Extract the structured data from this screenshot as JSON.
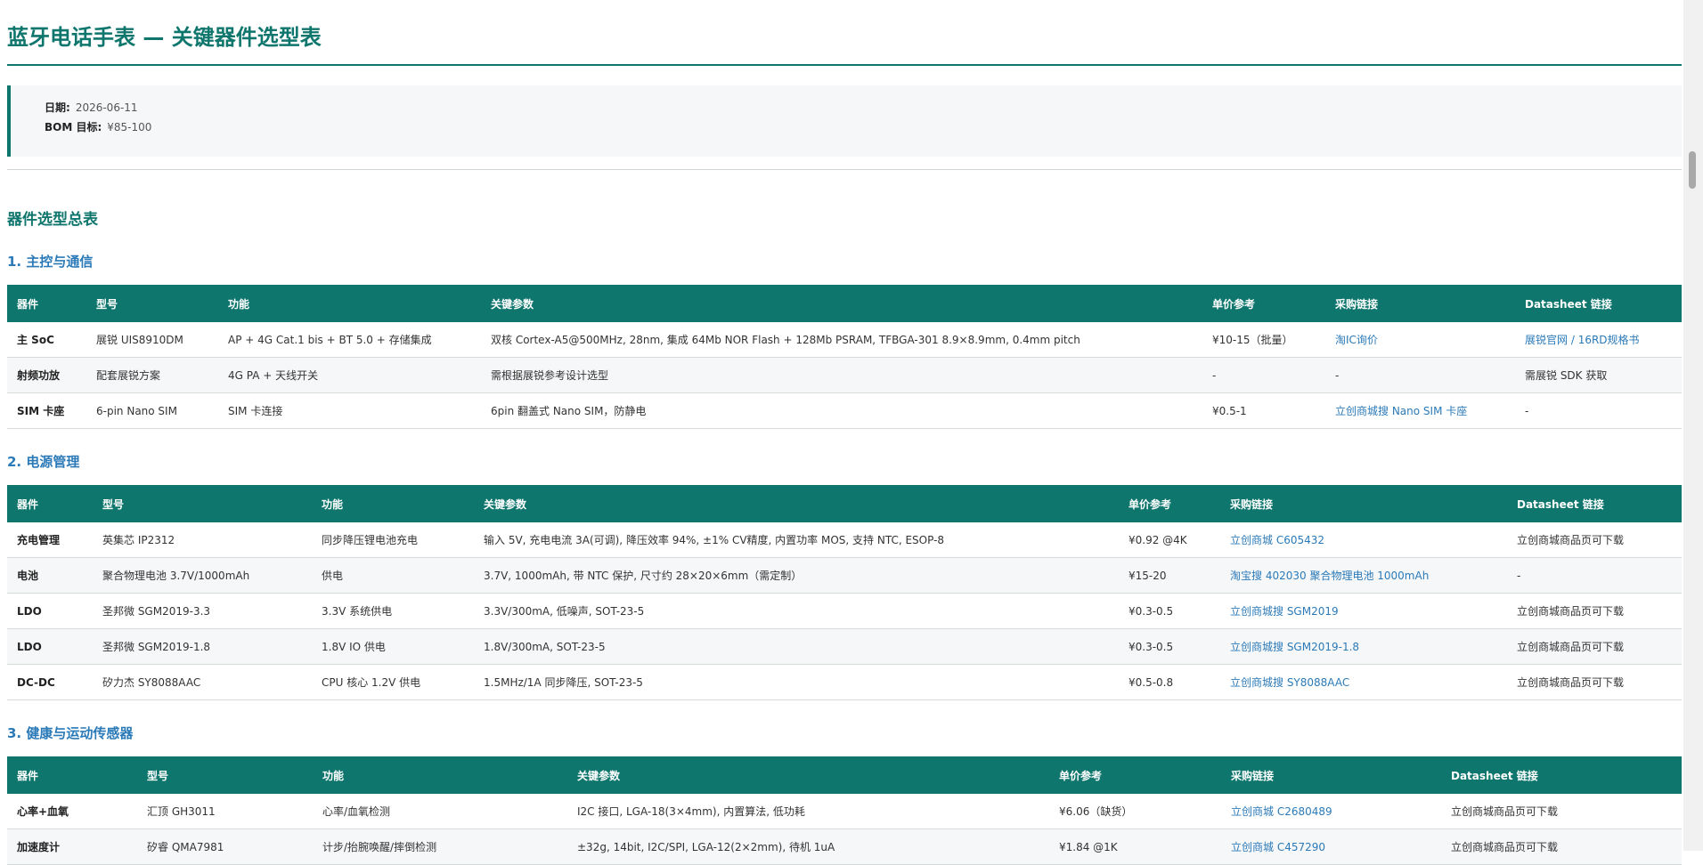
{
  "title": "蓝牙电话手表 — 关键器件选型表",
  "meta": {
    "date_label": "日期:",
    "date_value": "2026-06-11",
    "bom_label": "BOM 目标:",
    "bom_value": "¥85-100"
  },
  "summary_heading": "器件选型总表",
  "headers": [
    "器件",
    "型号",
    "功能",
    "关键参数",
    "单价参考",
    "采购链接",
    "Datasheet 链接"
  ],
  "sections": [
    {
      "title": "1. 主控与通信",
      "rows": [
        {
          "part": "主 SoC",
          "model": "展锐 UIS8910DM",
          "func": "AP + 4G Cat.1 bis + BT 5.0 + 存储集成",
          "params": "双核 Cortex-A5@500MHz, 28nm, 集成 64Mb NOR Flash + 128Mb PSRAM, TFBGA-301 8.9×8.9mm, 0.4mm pitch",
          "price": "¥10-15（批量）",
          "buy": "淘IC询价",
          "ds1": "展锐官网",
          "ds_sep": " / ",
          "ds2": "16RD规格书"
        },
        {
          "part": "射频功放",
          "model": "配套展锐方案",
          "func": "4G PA + 天线开关",
          "params": "需根据展锐参考设计选型",
          "price": "-",
          "buy": "-",
          "ds": "需展锐 SDK 获取"
        },
        {
          "part": "SIM 卡座",
          "model": "6-pin Nano SIM",
          "func": "SIM 卡连接",
          "params": "6pin 翻盖式 Nano SIM，防静电",
          "price": "¥0.5-1",
          "buy": "立创商城搜 Nano SIM 卡座",
          "ds": "-"
        }
      ]
    },
    {
      "title": "2. 电源管理",
      "rows": [
        {
          "part": "充电管理",
          "model": "英集芯 IP2312",
          "func": "同步降压锂电池充电",
          "params": "输入 5V, 充电电流 3A(可调), 降压效率 94%, ±1% CV精度, 内置功率 MOS, 支持 NTC, ESOP-8",
          "price": "¥0.92 @4K",
          "buy": "立创商城 C605432",
          "ds": "立创商城商品页可下载"
        },
        {
          "part": "电池",
          "model": "聚合物理电池 3.7V/1000mAh",
          "func": "供电",
          "params": "3.7V, 1000mAh, 带 NTC 保护, 尺寸约 28×20×6mm（需定制）",
          "price": "¥15-20",
          "buy": "淘宝搜 402030 聚合物理电池 1000mAh",
          "ds": "-"
        },
        {
          "part": "LDO",
          "model": "圣邦微 SGM2019-3.3",
          "func": "3.3V 系统供电",
          "params": "3.3V/300mA, 低噪声, SOT-23-5",
          "price": "¥0.3-0.5",
          "buy": "立创商城搜 SGM2019",
          "ds": "立创商城商品页可下载"
        },
        {
          "part": "LDO",
          "model": "圣邦微 SGM2019-1.8",
          "func": "1.8V IO 供电",
          "params": "1.8V/300mA, SOT-23-5",
          "price": "¥0.3-0.5",
          "buy": "立创商城搜 SGM2019-1.8",
          "ds": "立创商城商品页可下载"
        },
        {
          "part": "DC-DC",
          "model": "矽力杰 SY8088AAC",
          "func": "CPU 核心 1.2V 供电",
          "params": "1.5MHz/1A 同步降压, SOT-23-5",
          "price": "¥0.5-0.8",
          "buy": "立创商城搜 SY8088AAC",
          "ds": "立创商城商品页可下载"
        }
      ]
    },
    {
      "title": "3. 健康与运动传感器",
      "rows": [
        {
          "part": "心率+血氧",
          "model": "汇顶 GH3011",
          "func": "心率/血氧检测",
          "params": "I2C 接口, LGA-18(3×4mm), 内置算法, 低功耗",
          "price": "¥6.06（缺货）",
          "buy": "立创商城 C2680489",
          "ds": "立创商城商品页可下载"
        },
        {
          "part": "加速度计",
          "model": "矽睿 QMA7981",
          "func": "计步/抬腕唤醒/摔倒检测",
          "params": "±32g, 14bit, I2C/SPI, LGA-12(2×2mm), 待机 1uA",
          "price": "¥1.84 @1K",
          "buy": "立创商城 C457290",
          "ds": "立创商城商品页可下载"
        }
      ]
    }
  ]
}
